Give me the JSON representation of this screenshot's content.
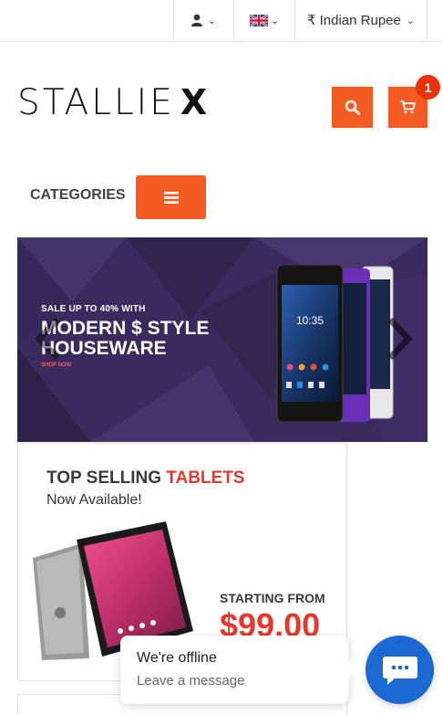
{
  "topbar": {
    "account_icon": "user-icon",
    "language_icon": "uk-flag-icon",
    "currency_label": "₹ Indian Rupee"
  },
  "brand": {
    "logo_main": "STALLIE",
    "logo_x": "X"
  },
  "actions": {
    "search_icon": "search-icon",
    "cart_icon": "cart-icon",
    "cart_count": "1"
  },
  "categories": {
    "label": "CATEGORIES",
    "menu_icon": "hamburger-icon"
  },
  "hero": {
    "subtitle": "SALE UP TO 40% WITH",
    "title_line1": "MODERN $ STYLE",
    "title_line2": "HOUSEWARE",
    "link": "SHOP NOW",
    "phone_time": "10:35"
  },
  "promo": {
    "title_prefix": "TOP SELLING",
    "title_accent": "TABLETS",
    "subtitle": "Now Available!",
    "from_label": "STARTING FROM",
    "price": "$99.00"
  },
  "chat": {
    "status": "We're offline",
    "prompt": "Leave a message"
  },
  "colors": {
    "accent": "#f35b22",
    "badge": "#e6330c",
    "hero_bg": "#3b2a5e",
    "chat_blue": "#1c6ad1",
    "promo_red": "#e6392e"
  }
}
